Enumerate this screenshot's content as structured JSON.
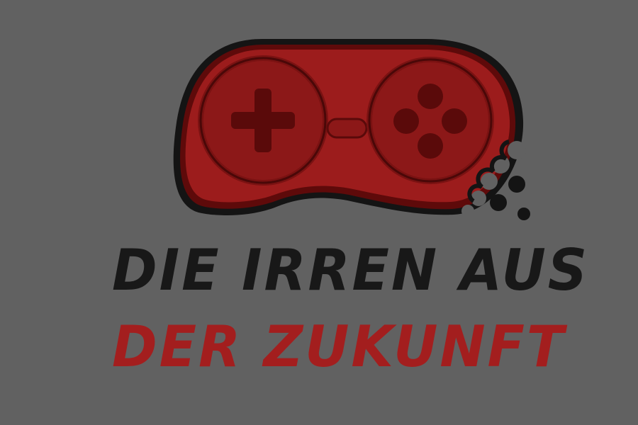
{
  "logo": {
    "line1": "DIE IRREN AUS",
    "line2": "DER ZUKUNFT",
    "icon": "bitten-gamepad-icon",
    "colors": {
      "background": "#616161",
      "controller_red": "#9c1c1c",
      "controller_dark": "#5e0a0a",
      "outline": "#141414",
      "text_dark": "#181818",
      "text_red": "#a31e1e"
    }
  }
}
